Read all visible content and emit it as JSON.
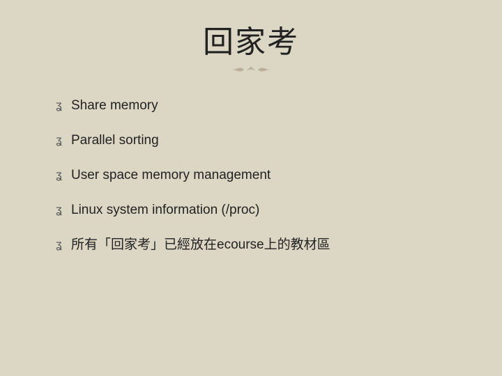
{
  "title": "回家考",
  "bullet_glyph": "ʓ",
  "items": [
    {
      "text": "Share memory"
    },
    {
      "text": "Parallel sorting"
    },
    {
      "text": "User space memory management"
    },
    {
      "text": "Linux system information (/proc)"
    },
    {
      "text": "所有「回家考」已經放在ecourse上的教材區"
    }
  ]
}
